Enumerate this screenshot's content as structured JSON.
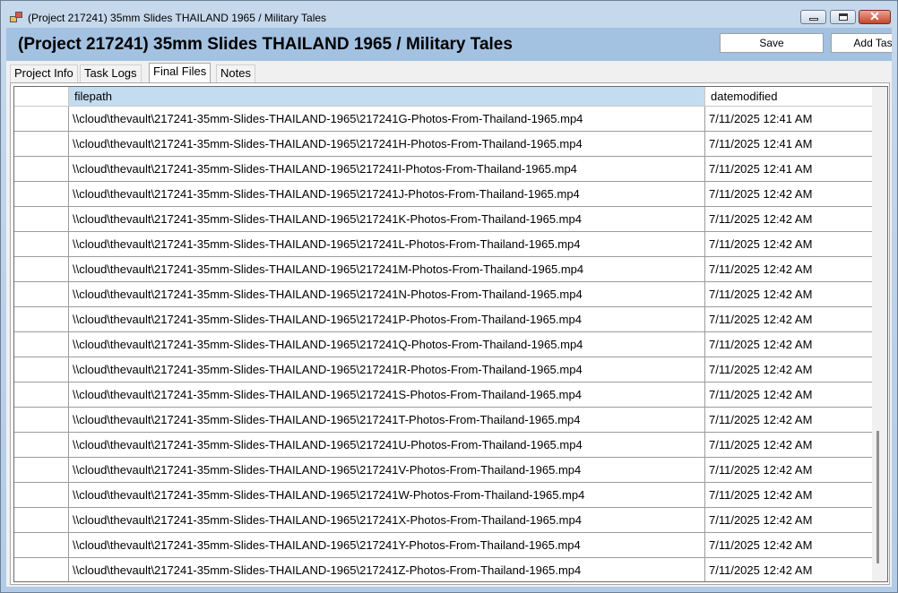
{
  "window": {
    "title": "(Project 217241) 35mm Slides THAILAND 1965 / Military Tales",
    "controls": {
      "close_glyph": "✕"
    }
  },
  "header": {
    "title": "(Project 217241) 35mm Slides THAILAND 1965 / Military Tales",
    "save_label": "Save",
    "add_label": "Add Task"
  },
  "tabs": [
    {
      "label": "Project Info"
    },
    {
      "label": "Task Logs"
    },
    {
      "label": "Final Files"
    },
    {
      "label": "Notes"
    }
  ],
  "active_tab": "Final Files",
  "grid": {
    "columns": [
      "filepath",
      "datemodified"
    ],
    "rows": [
      {
        "filepath": "\\\\cloud\\thevault\\217241-35mm-Slides-THAILAND-1965\\217241G-Photos-From-Thailand-1965.mp4",
        "datemodified": "7/11/2025 12:41 AM"
      },
      {
        "filepath": "\\\\cloud\\thevault\\217241-35mm-Slides-THAILAND-1965\\217241H-Photos-From-Thailand-1965.mp4",
        "datemodified": "7/11/2025 12:41 AM"
      },
      {
        "filepath": "\\\\cloud\\thevault\\217241-35mm-Slides-THAILAND-1965\\217241I-Photos-From-Thailand-1965.mp4",
        "datemodified": "7/11/2025 12:41 AM"
      },
      {
        "filepath": "\\\\cloud\\thevault\\217241-35mm-Slides-THAILAND-1965\\217241J-Photos-From-Thailand-1965.mp4",
        "datemodified": "7/11/2025 12:42 AM"
      },
      {
        "filepath": "\\\\cloud\\thevault\\217241-35mm-Slides-THAILAND-1965\\217241K-Photos-From-Thailand-1965.mp4",
        "datemodified": "7/11/2025 12:42 AM"
      },
      {
        "filepath": "\\\\cloud\\thevault\\217241-35mm-Slides-THAILAND-1965\\217241L-Photos-From-Thailand-1965.mp4",
        "datemodified": "7/11/2025 12:42 AM"
      },
      {
        "filepath": "\\\\cloud\\thevault\\217241-35mm-Slides-THAILAND-1965\\217241M-Photos-From-Thailand-1965.mp4",
        "datemodified": "7/11/2025 12:42 AM"
      },
      {
        "filepath": "\\\\cloud\\thevault\\217241-35mm-Slides-THAILAND-1965\\217241N-Photos-From-Thailand-1965.mp4",
        "datemodified": "7/11/2025 12:42 AM"
      },
      {
        "filepath": "\\\\cloud\\thevault\\217241-35mm-Slides-THAILAND-1965\\217241P-Photos-From-Thailand-1965.mp4",
        "datemodified": "7/11/2025 12:42 AM"
      },
      {
        "filepath": "\\\\cloud\\thevault\\217241-35mm-Slides-THAILAND-1965\\217241Q-Photos-From-Thailand-1965.mp4",
        "datemodified": "7/11/2025 12:42 AM"
      },
      {
        "filepath": "\\\\cloud\\thevault\\217241-35mm-Slides-THAILAND-1965\\217241R-Photos-From-Thailand-1965.mp4",
        "datemodified": "7/11/2025 12:42 AM"
      },
      {
        "filepath": "\\\\cloud\\thevault\\217241-35mm-Slides-THAILAND-1965\\217241S-Photos-From-Thailand-1965.mp4",
        "datemodified": "7/11/2025 12:42 AM"
      },
      {
        "filepath": "\\\\cloud\\thevault\\217241-35mm-Slides-THAILAND-1965\\217241T-Photos-From-Thailand-1965.mp4",
        "datemodified": "7/11/2025 12:42 AM"
      },
      {
        "filepath": "\\\\cloud\\thevault\\217241-35mm-Slides-THAILAND-1965\\217241U-Photos-From-Thailand-1965.mp4",
        "datemodified": "7/11/2025 12:42 AM"
      },
      {
        "filepath": "\\\\cloud\\thevault\\217241-35mm-Slides-THAILAND-1965\\217241V-Photos-From-Thailand-1965.mp4",
        "datemodified": "7/11/2025 12:42 AM"
      },
      {
        "filepath": "\\\\cloud\\thevault\\217241-35mm-Slides-THAILAND-1965\\217241W-Photos-From-Thailand-1965.mp4",
        "datemodified": "7/11/2025 12:42 AM"
      },
      {
        "filepath": "\\\\cloud\\thevault\\217241-35mm-Slides-THAILAND-1965\\217241X-Photos-From-Thailand-1965.mp4",
        "datemodified": "7/11/2025 12:42 AM"
      },
      {
        "filepath": "\\\\cloud\\thevault\\217241-35mm-Slides-THAILAND-1965\\217241Y-Photos-From-Thailand-1965.mp4",
        "datemodified": "7/11/2025 12:42 AM"
      },
      {
        "filepath": "\\\\cloud\\thevault\\217241-35mm-Slides-THAILAND-1965\\217241Z-Photos-From-Thailand-1965.mp4",
        "datemodified": "7/11/2025 12:42 AM"
      }
    ]
  },
  "colors": {
    "header_bg": "#a3c1e0",
    "selected_column_header": "#c3dcef",
    "close_button": "#c7452d"
  }
}
